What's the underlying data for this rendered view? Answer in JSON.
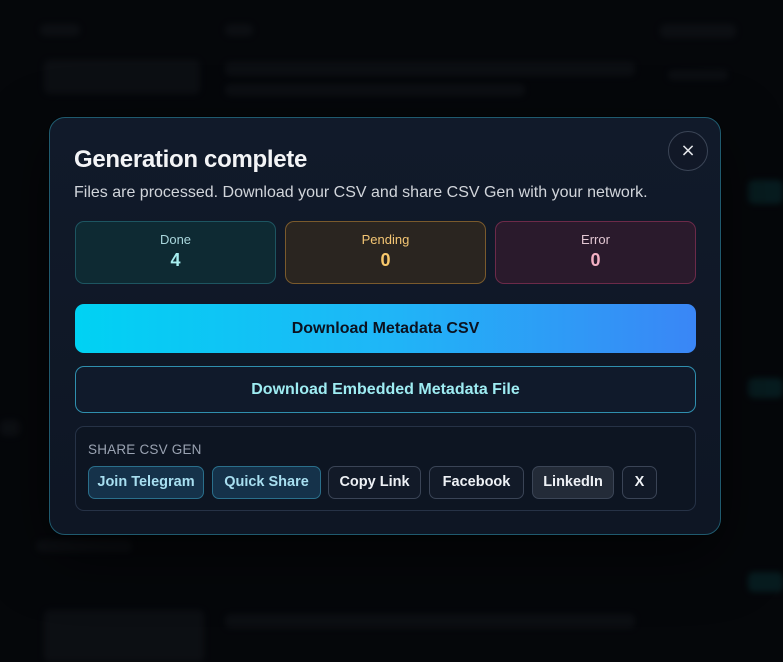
{
  "modal": {
    "title": "Generation complete",
    "subtitle": "Files are processed. Download your CSV and share CSV Gen with your network.",
    "close_icon": "×"
  },
  "stats": {
    "done": {
      "label": "Done",
      "value": "4"
    },
    "pending": {
      "label": "Pending",
      "value": "0"
    },
    "error": {
      "label": "Error",
      "value": "0"
    }
  },
  "actions": {
    "download_csv": "Download Metadata CSV",
    "download_embedded": "Download Embedded Metadata File"
  },
  "share": {
    "heading": "SHARE CSV GEN",
    "buttons": {
      "telegram": "Join Telegram",
      "quick_share": "Quick Share",
      "copy_link": "Copy Link",
      "facebook": "Facebook",
      "linkedin": "LinkedIn",
      "x": "X"
    }
  },
  "colors": {
    "primary_gradient_start": "#00d2f3",
    "primary_gradient_end": "#3a86f6",
    "done": "#a7eef0",
    "pending": "#f8c86b",
    "error": "#f4b0c4"
  }
}
